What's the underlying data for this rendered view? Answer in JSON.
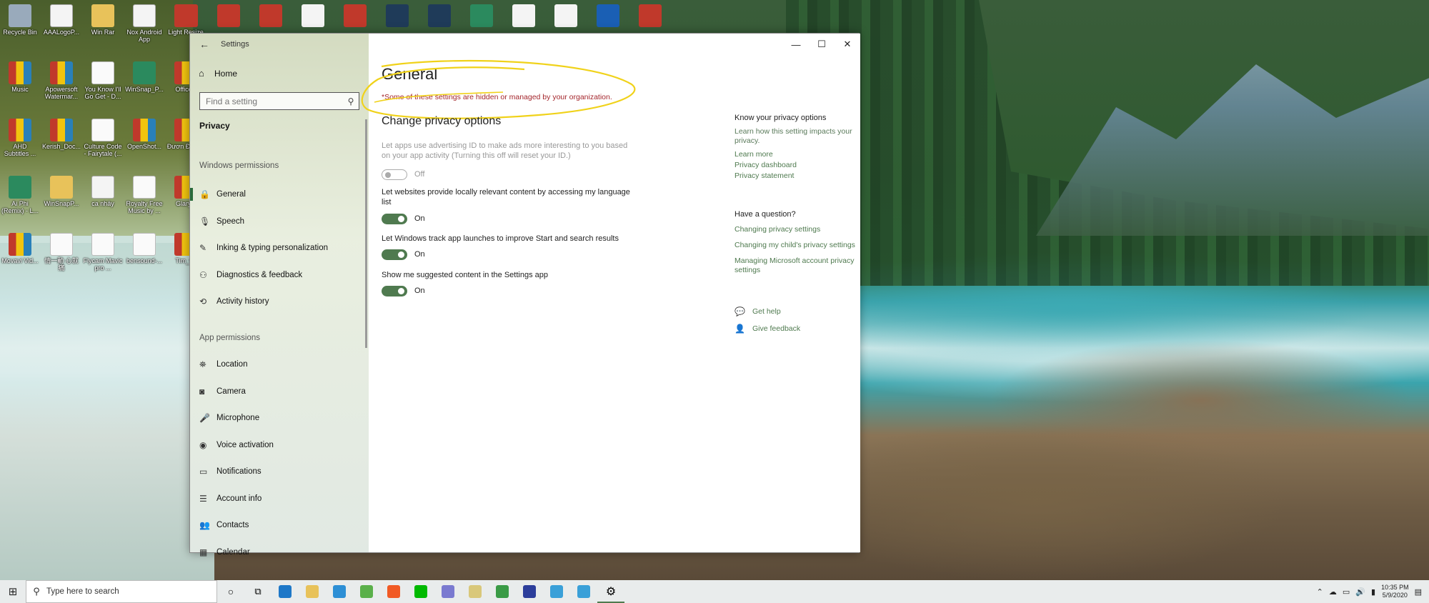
{
  "desktop": {
    "icons": [
      {
        "label": "Recycle Bin",
        "kind": "g-bin"
      },
      {
        "label": "AAALogoP...",
        "kind": "g-doc"
      },
      {
        "label": "Win Rar",
        "kind": "g-folder"
      },
      {
        "label": "Nox Android App",
        "kind": "g-doc"
      },
      {
        "label": "Light Resize",
        "kind": "g-rar"
      },
      {
        "label": "Music",
        "kind": "g-rar"
      },
      {
        "label": "Apowersoft Watermar...",
        "kind": "g-rar"
      },
      {
        "label": "You Know I'll Go Get - D...",
        "kind": "g-mp3"
      },
      {
        "label": "WinSnap_P...",
        "kind": "g-app"
      },
      {
        "label": "OfficeP",
        "kind": "g-rar"
      },
      {
        "label": "AHD Subtitles ...",
        "kind": "g-rar"
      },
      {
        "label": "Kerish_Doc...",
        "kind": "g-rar"
      },
      {
        "label": "Culture Code - Fairytale (...",
        "kind": "g-mp3"
      },
      {
        "label": "OpenShot...",
        "kind": "g-rar"
      },
      {
        "label": "Đươn Đảm p",
        "kind": "g-rar"
      },
      {
        "label": "Ai Phi (Remix) - L...",
        "kind": "g-app"
      },
      {
        "label": "WinSnapP...",
        "kind": "g-folder"
      },
      {
        "label": "ca nhảy",
        "kind": "g-doc"
      },
      {
        "label": "Royalty Free Music by ...",
        "kind": "g-mp3"
      },
      {
        "label": "GlaryU",
        "kind": "g-rar"
      },
      {
        "label": "Movavi Vid...",
        "kind": "g-rar"
      },
      {
        "label": "情一動 心就痛",
        "kind": "g-mp3"
      },
      {
        "label": "Flycam Mavic pro ...",
        "kind": "g-mp3"
      },
      {
        "label": "bensound-...",
        "kind": "g-mp3"
      },
      {
        "label": "Tim_ve",
        "kind": "g-rar"
      }
    ]
  },
  "window": {
    "title": "Settings",
    "controls": {
      "minimize": "—",
      "maximize": "☐",
      "close": "✕"
    }
  },
  "sidebar": {
    "home": "Home",
    "search_placeholder": "Find a setting",
    "category": "Privacy",
    "windows_permissions_label": "Windows permissions",
    "windows_permissions": [
      {
        "label": "General",
        "icon": "lock-icon"
      },
      {
        "label": "Speech",
        "icon": "speech-icon"
      },
      {
        "label": "Inking & typing personalization",
        "icon": "pen-icon"
      },
      {
        "label": "Diagnostics & feedback",
        "icon": "feedback-icon"
      },
      {
        "label": "Activity history",
        "icon": "history-icon"
      }
    ],
    "app_permissions_label": "App permissions",
    "app_permissions": [
      {
        "label": "Location",
        "icon": "location-icon"
      },
      {
        "label": "Camera",
        "icon": "camera-icon"
      },
      {
        "label": "Microphone",
        "icon": "microphone-icon"
      },
      {
        "label": "Voice activation",
        "icon": "voice-icon"
      },
      {
        "label": "Notifications",
        "icon": "notifications-icon"
      },
      {
        "label": "Account info",
        "icon": "account-icon"
      },
      {
        "label": "Contacts",
        "icon": "contacts-icon"
      },
      {
        "label": "Calendar",
        "icon": "calendar-icon"
      }
    ]
  },
  "main": {
    "title": "General",
    "warning": "*Some of these settings are hidden or managed by your organization.",
    "section": "Change privacy options",
    "options": [
      {
        "desc": "Let apps use advertising ID to make ads more interesting to you based on your app activity (Turning this off will reset your ID.)",
        "state": "Off",
        "enabled": false
      },
      {
        "desc": "Let websites provide locally relevant content by accessing my language list",
        "state": "On",
        "enabled": true
      },
      {
        "desc": "Let Windows track app launches to improve Start and search results",
        "state": "On",
        "enabled": true
      },
      {
        "desc": "Show me suggested content in the Settings app",
        "state": "On",
        "enabled": true
      }
    ]
  },
  "aside": {
    "know_title": "Know your privacy options",
    "know_text": "Learn how this setting impacts your privacy.",
    "links": [
      "Learn more",
      "Privacy dashboard",
      "Privacy statement"
    ],
    "question_title": "Have a question?",
    "question_links": [
      "Changing privacy settings",
      "Changing my child's privacy settings",
      "Managing Microsoft account privacy settings"
    ],
    "get_help": "Get help",
    "give_feedback": "Give feedback"
  },
  "taskbar": {
    "search_placeholder": "Type here to search",
    "time": "10:35 PM",
    "date": "5/9/2020",
    "pinned": [
      {
        "name": "edge",
        "color": "#1e78c8"
      },
      {
        "name": "file-explorer",
        "color": "#e8c25a"
      },
      {
        "name": "browser",
        "color": "#2d8fd5"
      },
      {
        "name": "app-green",
        "color": "#5ab04a"
      },
      {
        "name": "brave",
        "color": "#f15a24"
      },
      {
        "name": "line",
        "color": "#00b900"
      },
      {
        "name": "music",
        "color": "#7a7ad0"
      },
      {
        "name": "app-yellow",
        "color": "#d9c87a"
      },
      {
        "name": "app-globe",
        "color": "#3a9b46"
      },
      {
        "name": "app-blue",
        "color": "#2c3e9b"
      },
      {
        "name": "winsnap-1",
        "color": "#3aa0d8"
      },
      {
        "name": "winsnap-2",
        "color": "#3aa0d8"
      },
      {
        "name": "settings",
        "color": "#555555"
      }
    ]
  }
}
